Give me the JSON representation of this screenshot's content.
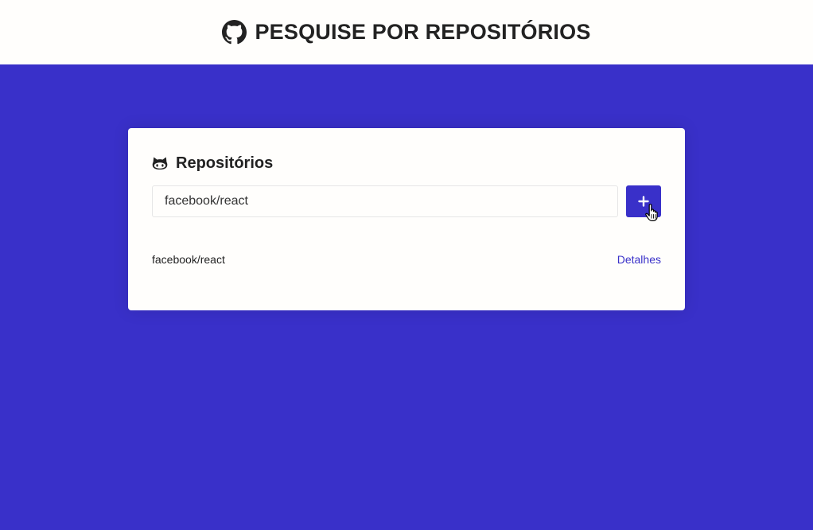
{
  "header": {
    "title": "PESQUISE POR REPOSITÓRIOS",
    "icon": "github-icon"
  },
  "card": {
    "title": "Repositórios",
    "icon": "cat-icon"
  },
  "form": {
    "input_value": "facebook/react",
    "add_button_icon": "plus-icon"
  },
  "repositories": [
    {
      "name": "facebook/react",
      "link_label": "Detalhes"
    }
  ],
  "colors": {
    "accent": "#3930c9",
    "background": "#3930c9",
    "surface": "#fffefc",
    "text": "#222222"
  }
}
